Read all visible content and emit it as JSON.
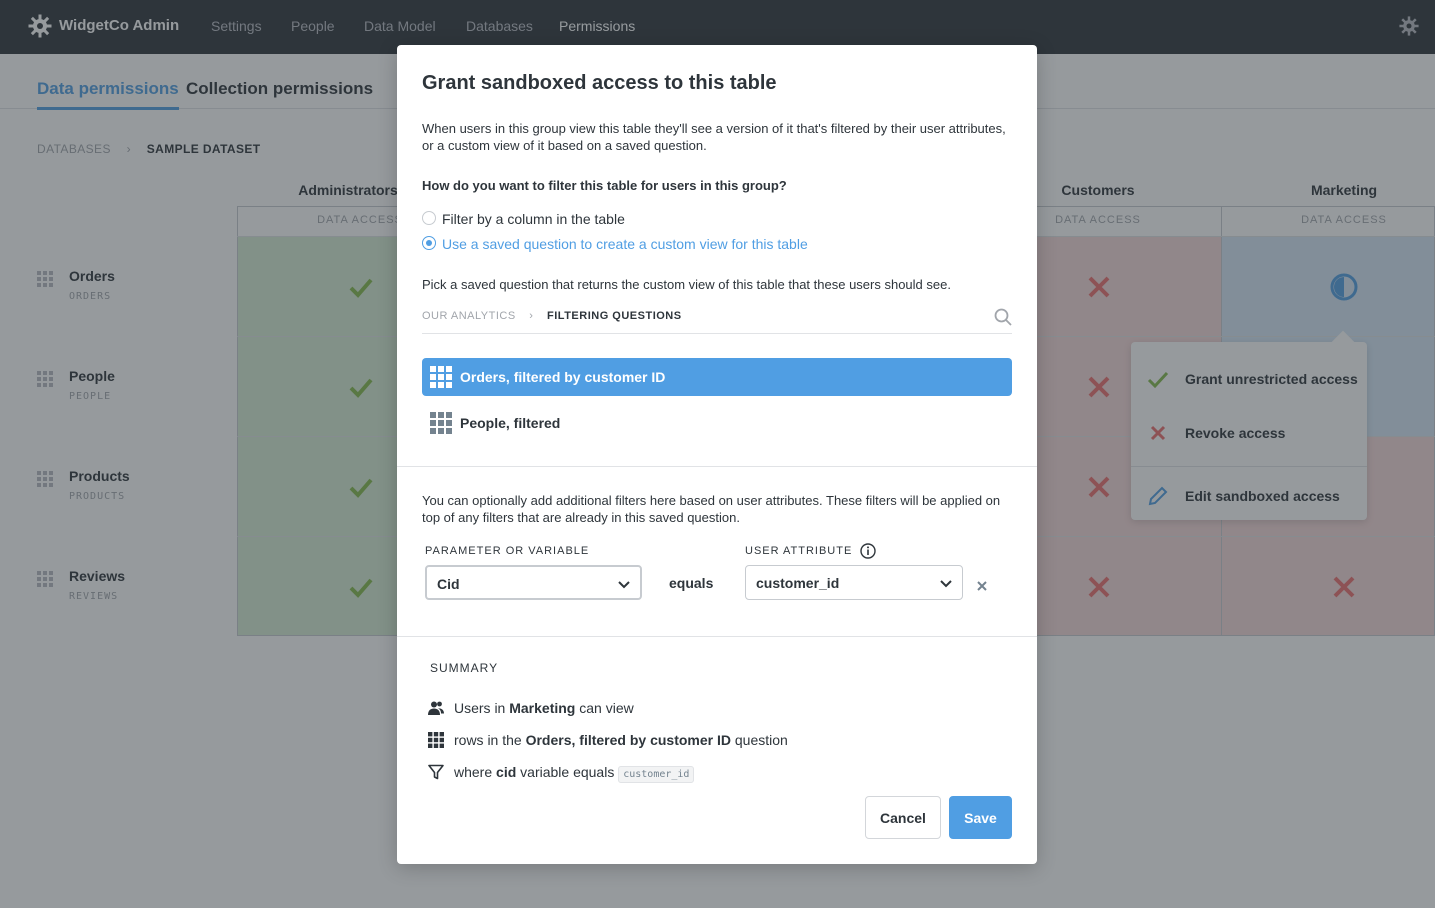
{
  "nav": {
    "app_title": "WidgetCo Admin",
    "items": [
      "Settings",
      "People",
      "Data Model",
      "Databases",
      "Permissions"
    ],
    "active": "Permissions"
  },
  "tabs": [
    "Data permissions",
    "Collection permissions"
  ],
  "breadcrumb": {
    "root": "DATABASES",
    "current": "SAMPLE DATASET"
  },
  "groups": [
    {
      "name": "Administrators",
      "sub": "DATA ACCESS"
    },
    {
      "name": "Customers",
      "sub": "DATA ACCESS"
    },
    {
      "name": "Marketing",
      "sub": "DATA ACCESS"
    }
  ],
  "tables": [
    {
      "name": "Orders",
      "sub": "ORDERS"
    },
    {
      "name": "People",
      "sub": "PEOPLE"
    },
    {
      "name": "Products",
      "sub": "PRODUCTS"
    },
    {
      "name": "Reviews",
      "sub": "REVIEWS"
    }
  ],
  "popover": {
    "items": [
      "Grant unrestricted access",
      "Revoke access",
      "Edit sandboxed access"
    ]
  },
  "modal": {
    "title": "Grant sandboxed access to this table",
    "description": "When users in this group view this table they'll see a version of it that's filtered by their user attributes, or a custom view of it based on a saved question.",
    "question": "How do you want to filter this table for users in this group?",
    "options": [
      "Filter by a column in the table",
      "Use a saved question to create a custom view for this table"
    ],
    "pick_prompt": "Pick a saved question that returns the custom view of this table that these users should see.",
    "picker_breadcrumb": {
      "root": "OUR ANALYTICS",
      "current": "FILTERING QUESTIONS"
    },
    "questions": [
      "Orders, filtered by customer ID",
      "People, filtered"
    ],
    "optional_text": "You can optionally add additional filters here based on user attributes. These filters will be applied on top of any filters that are already in this saved question.",
    "param_label": "PARAMETER OR VARIABLE",
    "attr_label": "USER ATTRIBUTE",
    "param_value": "Cid",
    "equals": "equals",
    "attr_value": "customer_id",
    "summary": {
      "title": "SUMMARY",
      "line1_pre": "Users in ",
      "line1_bold": "Marketing",
      "line1_post": " can view",
      "line2_pre": "rows in the ",
      "line2_bold": "Orders, filtered by customer ID",
      "line2_post": " question",
      "line3_pre": "where ",
      "line3_bold": "cid",
      "line3_post": " variable equals ",
      "line3_code": "customer_id"
    },
    "cancel": "Cancel",
    "save": "Save"
  },
  "colors": {
    "accent": "#509ee3",
    "green": "#84bb4c",
    "red": "#ed6e6e"
  }
}
